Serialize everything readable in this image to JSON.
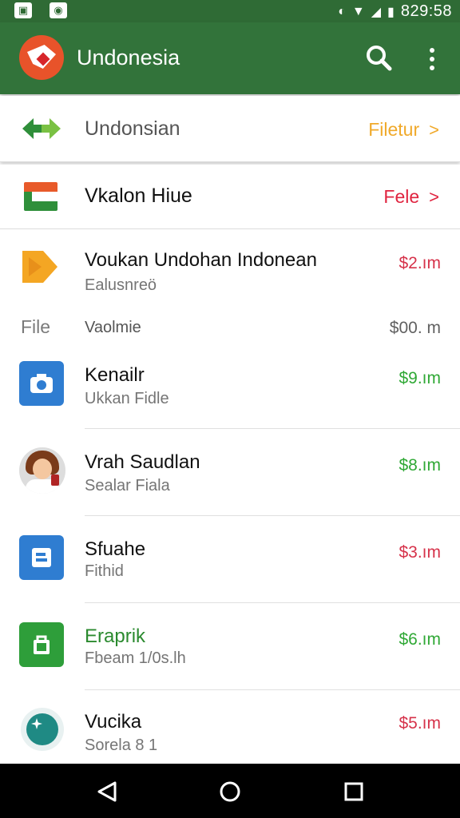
{
  "status_bar": {
    "time": "829:58",
    "icons": [
      "image-icon",
      "notification-icon",
      "vibrate-icon",
      "wifi-icon",
      "signal-icon",
      "battery-icon"
    ]
  },
  "app_bar": {
    "title": "Undonesia",
    "actions": [
      "search-icon",
      "more-vert-icon"
    ],
    "color": "#32733a"
  },
  "header_rows": [
    {
      "label": "Undonsian",
      "action": "Filetur",
      "action_color": "#f0a92a",
      "icon": "arrows-icon"
    },
    {
      "label": "Vkalon Hiue",
      "action": "Fele",
      "action_color": "#e0233f",
      "icon": "flag-icon"
    }
  ],
  "items": [
    {
      "title": "Voukan Undohan Indonean",
      "subtitle": "Ealusnreö",
      "amount": "$2.ım",
      "amount_color": "#d6324a",
      "icon": "tag-icon"
    },
    {
      "title": "Vaolmie",
      "amount": "$00. m",
      "amount_color": "#616161",
      "side_label": "File"
    },
    {
      "title": "Kenailr",
      "subtitle": "Ukkan Fidle",
      "amount": "$9.ım",
      "amount_color": "#2fa835",
      "icon": "camera-icon"
    },
    {
      "title": "Vrah Saudlan",
      "subtitle": "Sealar Fiala",
      "amount": "$8.ım",
      "amount_color": "#2fa835",
      "icon": "avatar-icon"
    },
    {
      "title": "Sfuahe",
      "subtitle": "Fithid",
      "amount": "$3.ım",
      "amount_color": "#d6324a",
      "icon": "document-icon"
    },
    {
      "title": "Eraprik",
      "title_color": "#2b8a2f",
      "subtitle": "Fbeam 1/0s.lh",
      "amount": "$6.ım",
      "amount_color": "#2fa835",
      "icon": "shopping-bag-icon"
    },
    {
      "title": "Vucika",
      "subtitle": "Sorela 8 1",
      "amount": "$5.ım",
      "amount_color": "#d6324a",
      "icon": "compass-icon"
    }
  ],
  "nav_bar": [
    "back-icon",
    "home-icon",
    "recents-icon"
  ]
}
